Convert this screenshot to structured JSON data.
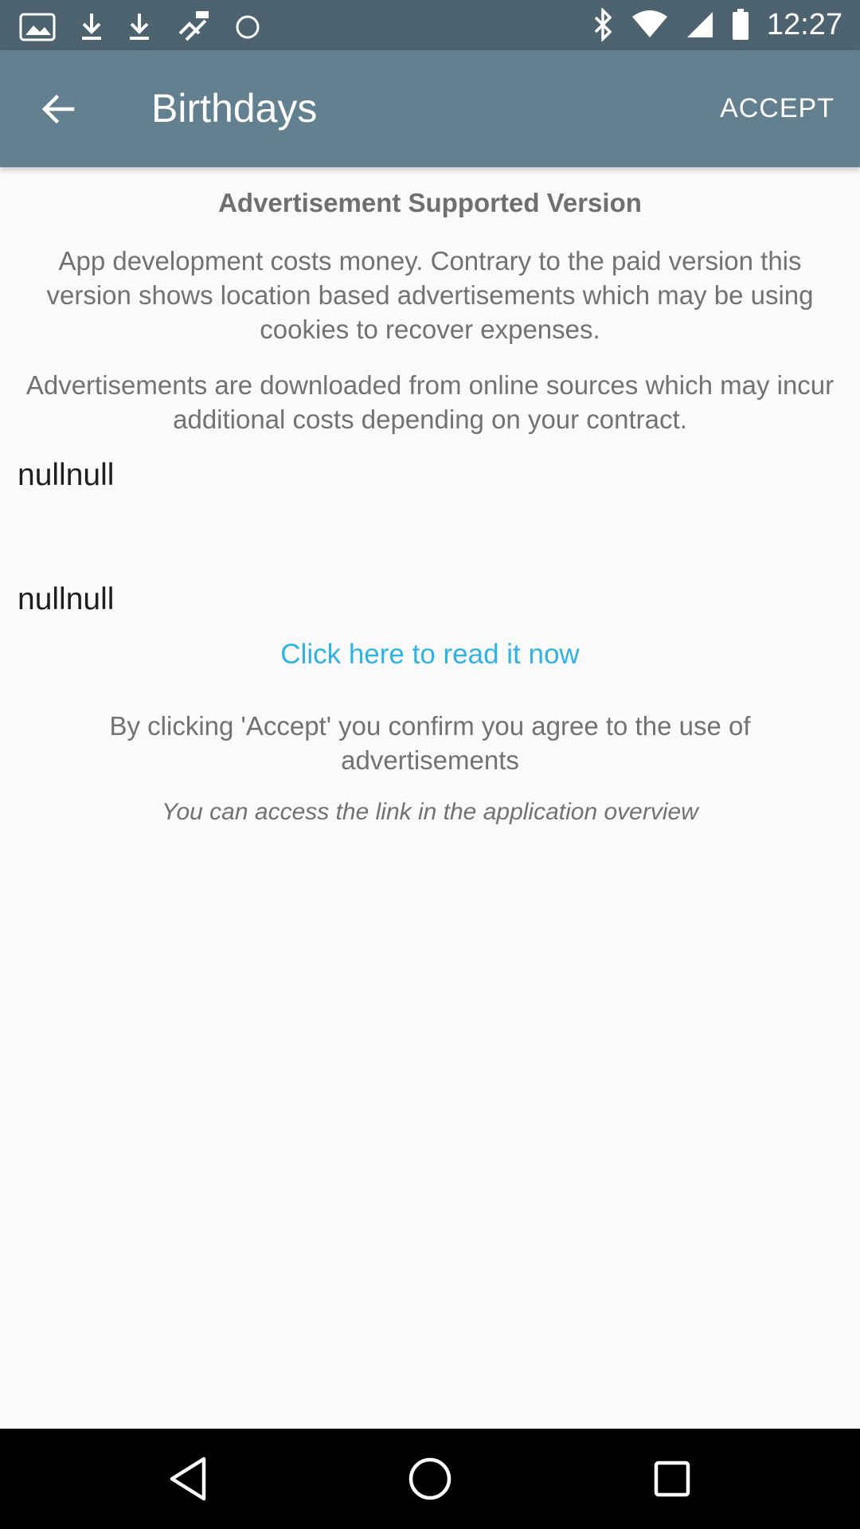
{
  "status_bar": {
    "time": "12:27",
    "icons": [
      "image-icon",
      "download-icon",
      "download-icon",
      "fake-gps-icon",
      "circle-icon",
      "bluetooth-icon",
      "wifi-icon",
      "cellular-signal-icon",
      "battery-icon"
    ]
  },
  "app_bar": {
    "title": "Birthdays",
    "accept_label": "ACCEPT",
    "back_icon": "arrow-back-icon"
  },
  "content": {
    "heading": "Advertisement Supported Version",
    "paragraph_1": "App development costs money. Contrary to the paid version this version shows location based advertisements which may be using cookies to recover expenses.",
    "paragraph_2": "Advertisements are downloaded from online sources which may incur additional costs depending on your contract.",
    "null_text_1": "nullnull",
    "null_text_2": "nullnull",
    "link_text": "Click here to read it now",
    "paragraph_3": "By clicking 'Accept' you confirm you agree to the use of advertisements",
    "note": "You can access the link in the application overview"
  },
  "nav_bar": {
    "icons": [
      "nav-back-icon",
      "nav-home-icon",
      "nav-recents-icon"
    ]
  },
  "colors": {
    "status_bar": "#4d6370",
    "app_bar": "#62808f",
    "background": "#fafafa",
    "link": "#2fb3e3",
    "body_text": "#727272"
  }
}
